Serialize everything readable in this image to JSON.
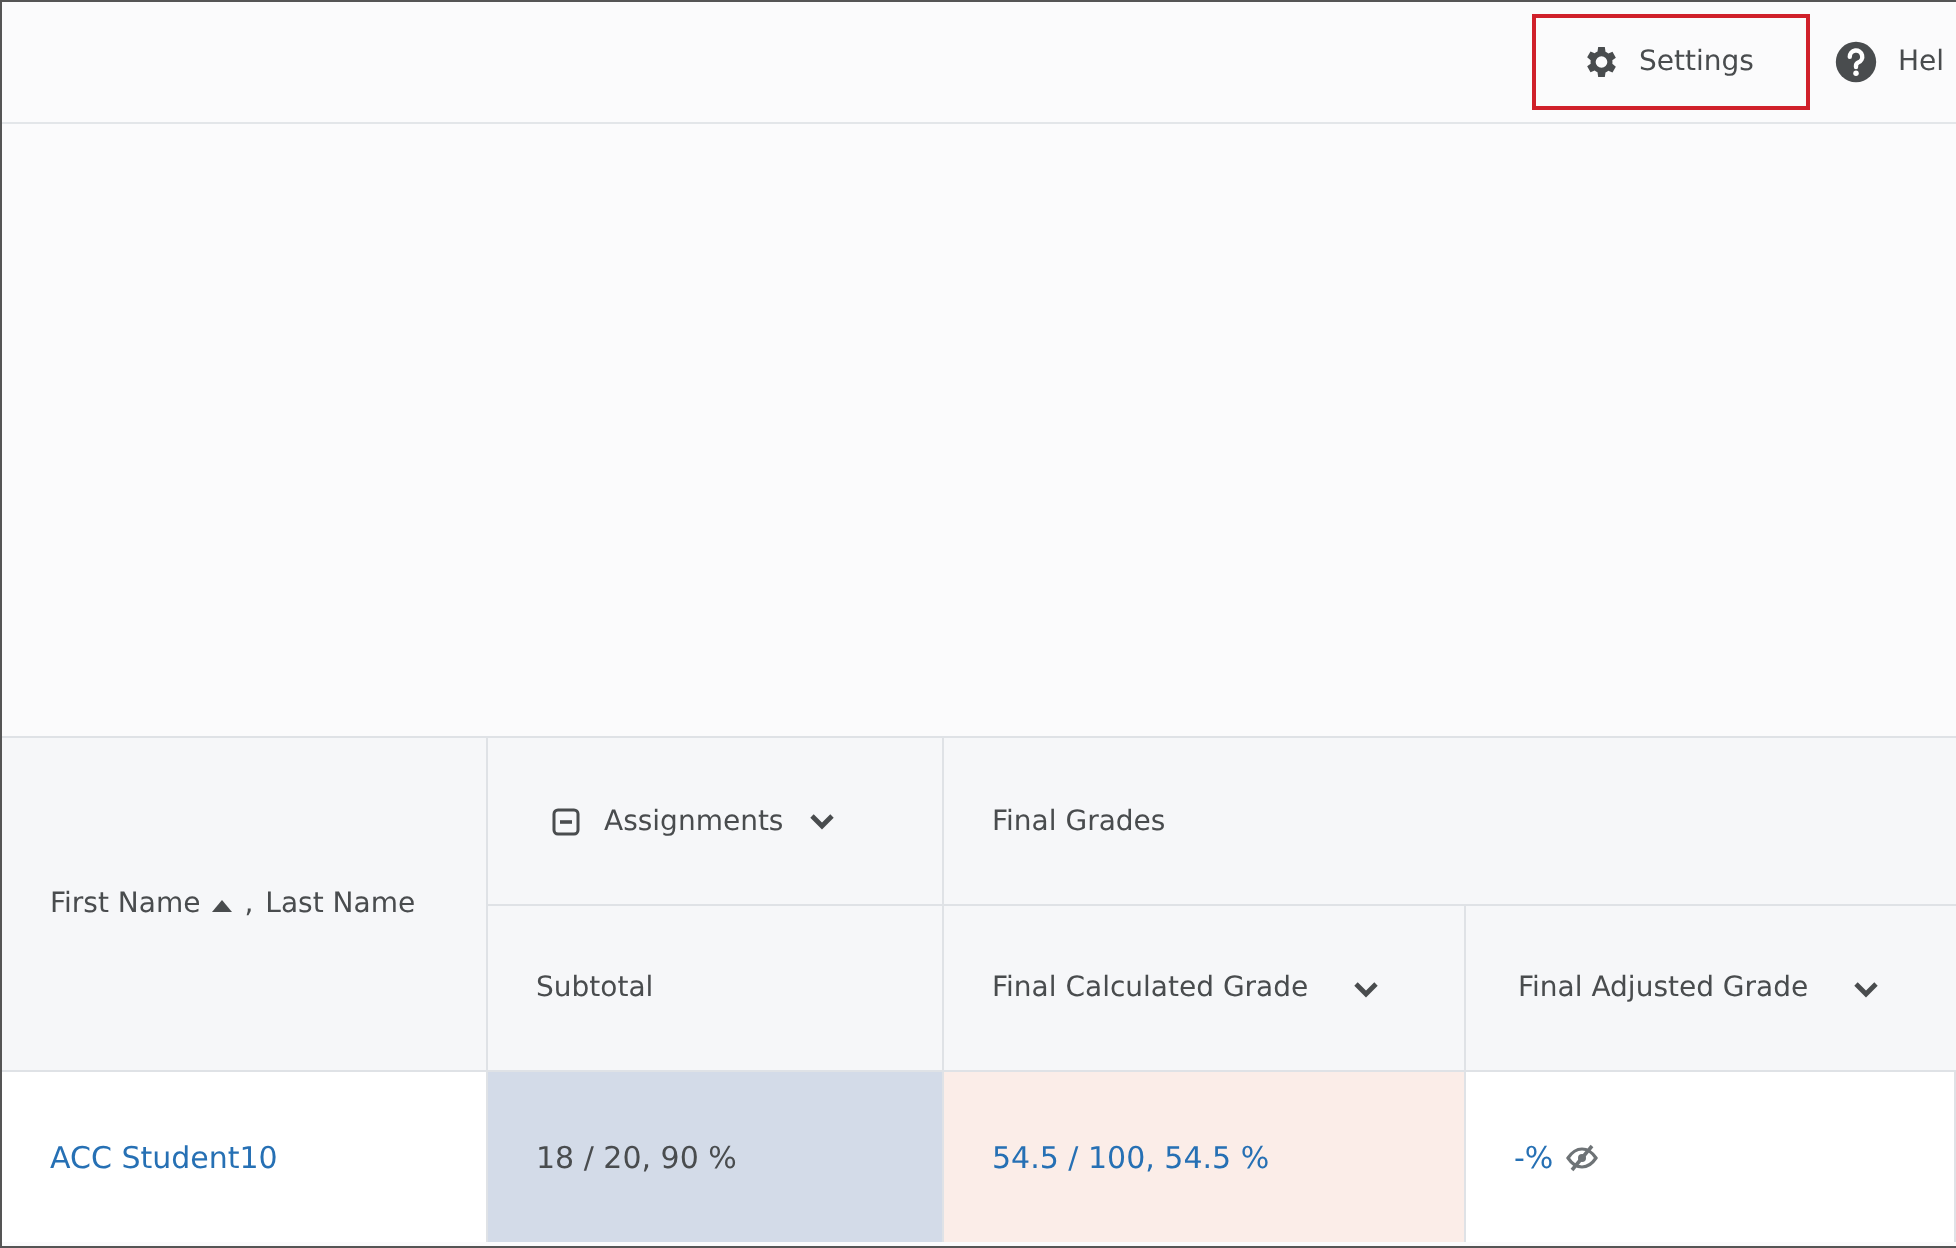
{
  "toolbar": {
    "buttons": [
      {
        "kind": "settings",
        "label": "Settings",
        "highlighted": true
      },
      {
        "kind": "help",
        "label": "Hel",
        "highlighted": false
      }
    ]
  },
  "table": {
    "name_header": {
      "first": "First Name",
      "sorted_ascending": true,
      "separator": ",",
      "last": "Last Name"
    },
    "groups": [
      {
        "label": "Assignments",
        "collapsible": true,
        "menu": true
      },
      {
        "label": "Final Grades",
        "collapsible": false,
        "menu": false
      }
    ],
    "columns": [
      {
        "label": "Subtotal",
        "menu": false
      },
      {
        "label": "Final Calculated Grade",
        "menu": true
      },
      {
        "label": "Final Adjusted Grade",
        "menu": true
      }
    ],
    "rows": [
      {
        "name": "ACC Student10",
        "cells": [
          {
            "text": "18 / 20, 90 %",
            "color": "#d3dbe8",
            "link": false,
            "hidden": false
          },
          {
            "text": "54.5 / 100, 54.5 %",
            "color": "#fbede8",
            "link": true,
            "hidden": false
          },
          {
            "text": "-%",
            "color": "#ffffff",
            "link": true,
            "hidden": true
          }
        ]
      }
    ]
  }
}
